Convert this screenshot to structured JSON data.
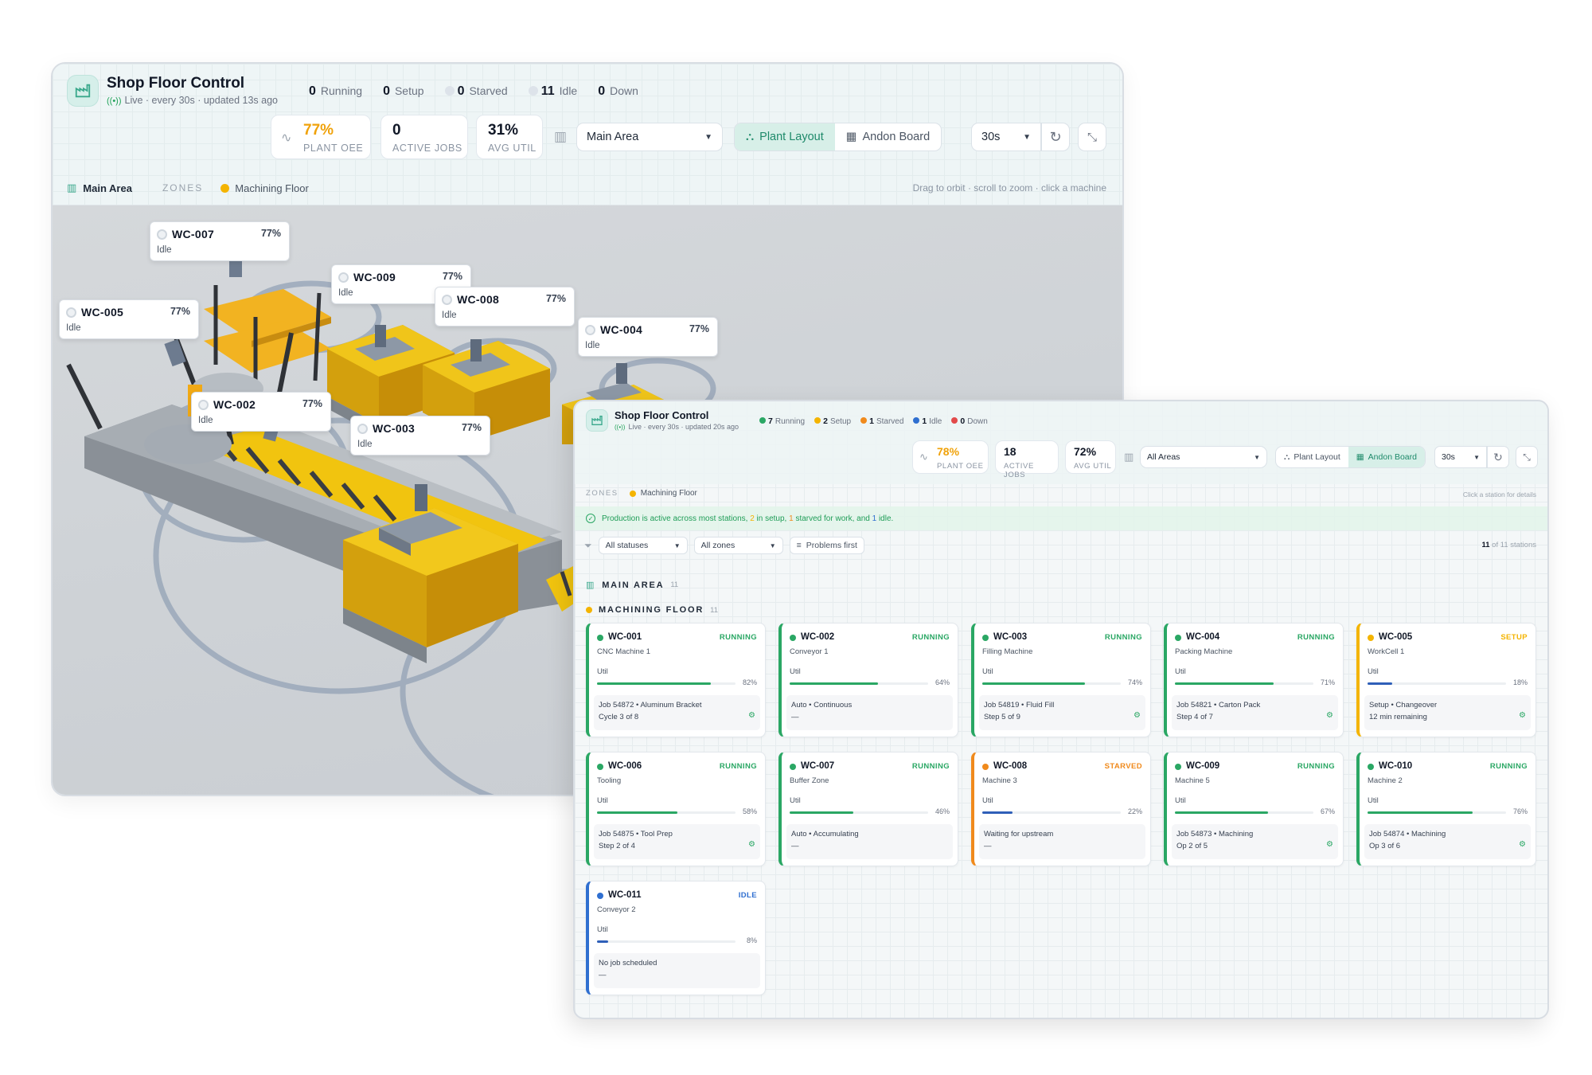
{
  "back": {
    "title": "Shop Floor Control",
    "subtitle": "Live · every 30s · updated 13s ago",
    "counts": [
      {
        "value": "0",
        "label": "Running"
      },
      {
        "value": "0",
        "label": "Setup"
      },
      {
        "value": "0",
        "label": "Starved"
      },
      {
        "value": "11",
        "label": "Idle"
      },
      {
        "value": "0",
        "label": "Down"
      }
    ],
    "kpis": {
      "oee": {
        "value": "77%",
        "label": "Plant OEE"
      },
      "jobs": {
        "value": "0",
        "label": "Active Jobs"
      },
      "util": {
        "value": "31%",
        "label": "Avg Util"
      }
    },
    "area_select": "Main Area",
    "view_plant": "Plant Layout",
    "view_andon": "Andon Board",
    "interval": "30s",
    "area_label": "Main Area",
    "zones_label": "ZONES",
    "zone_name": "Machining Floor",
    "hint": "Drag to orbit · scroll to zoom · click a machine",
    "machines": [
      {
        "id": "WC-007",
        "pct": "77%",
        "status": "Idle"
      },
      {
        "id": "WC-009",
        "pct": "77%",
        "status": "Idle"
      },
      {
        "id": "WC-005",
        "pct": "77%",
        "status": "Idle"
      },
      {
        "id": "WC-008",
        "pct": "77%",
        "status": "Idle"
      },
      {
        "id": "WC-004",
        "pct": "77%",
        "status": "Idle"
      },
      {
        "id": "WC-002",
        "pct": "77%",
        "status": "Idle"
      },
      {
        "id": "WC-003",
        "pct": "77%",
        "status": "Idle"
      }
    ]
  },
  "front": {
    "title": "Shop Floor Control",
    "subtitle": "Live · every 30s · updated 20s ago",
    "counts": [
      {
        "value": "7",
        "label": "Running",
        "color": "#2aa764"
      },
      {
        "value": "2",
        "label": "Setup",
        "color": "#f4b400"
      },
      {
        "value": "1",
        "label": "Starved",
        "color": "#f08a1c"
      },
      {
        "value": "1",
        "label": "Idle",
        "color": "#2f6fd0"
      },
      {
        "value": "0",
        "label": "Down",
        "color": "#e24a4a"
      }
    ],
    "kpis": {
      "oee": {
        "value": "78%",
        "label": "Plant OEE"
      },
      "jobs": {
        "value": "18",
        "label": "Active Jobs"
      },
      "util": {
        "value": "72%",
        "label": "Avg Util"
      }
    },
    "area_select": "All Areas",
    "view_plant": "Plant Layout",
    "view_andon": "Andon Board",
    "interval": "30s",
    "zones_label": "ZONES",
    "zone_name": "Machining Floor",
    "zone_hint": "Click a station for details",
    "banner": {
      "a": "Production is active across most stations, ",
      "n1": "2",
      "b": " in setup, ",
      "n2": "1",
      "c": " starved for work, and ",
      "n3": "1",
      "d": " idle."
    },
    "filters": {
      "status": "All statuses",
      "zones": "All zones",
      "problems": "Problems first"
    },
    "station_count": {
      "shown": "11",
      "rest": " of 11 stations"
    },
    "section_area": {
      "label": "MAIN AREA",
      "count": "11"
    },
    "section_zone": {
      "label": "MACHINING FLOOR",
      "count": "11"
    },
    "util_label": "Util",
    "stations": [
      {
        "id": "WC-001",
        "name": "CNC Machine 1",
        "status": "RUNNING",
        "util": 82,
        "util_text": "82%",
        "line1": "Job 54872 • Aluminum Bracket",
        "line2": "Cycle 3 of 8",
        "kind": "running"
      },
      {
        "id": "WC-002",
        "name": "Conveyor 1",
        "status": "RUNNING",
        "util": 64,
        "util_text": "64%",
        "line1": "Auto • Continuous",
        "line2": "—",
        "kind": "running"
      },
      {
        "id": "WC-003",
        "name": "Filling Machine",
        "status": "RUNNING",
        "util": 74,
        "util_text": "74%",
        "line1": "Job 54819 • Fluid Fill",
        "line2": "Step 5 of 9",
        "kind": "running"
      },
      {
        "id": "WC-004",
        "name": "Packing Machine",
        "status": "RUNNING",
        "util": 71,
        "util_text": "71%",
        "line1": "Job 54821 • Carton Pack",
        "line2": "Step 4 of 7",
        "kind": "running"
      },
      {
        "id": "WC-005",
        "name": "WorkCell 1",
        "status": "SETUP",
        "util": 18,
        "util_text": "18%",
        "line1": "Setup • Changeover",
        "line2": "12 min remaining",
        "kind": "setup"
      },
      {
        "id": "WC-006",
        "name": "Tooling",
        "status": "RUNNING",
        "util": 58,
        "util_text": "58%",
        "line1": "Job 54875 • Tool Prep",
        "line2": "Step 2 of 4",
        "kind": "running"
      },
      {
        "id": "WC-007",
        "name": "Buffer Zone",
        "status": "RUNNING",
        "util": 46,
        "util_text": "46%",
        "line1": "Auto • Accumulating",
        "line2": "—",
        "kind": "running"
      },
      {
        "id": "WC-008",
        "name": "Machine 3",
        "status": "STARVED",
        "util": 22,
        "util_text": "22%",
        "line1": "Waiting for upstream",
        "line2": "—",
        "kind": "starved"
      },
      {
        "id": "WC-009",
        "name": "Machine 5",
        "status": "RUNNING",
        "util": 67,
        "util_text": "67%",
        "line1": "Job 54873 • Machining",
        "line2": "Op 2 of 5",
        "kind": "running"
      },
      {
        "id": "WC-010",
        "name": "Machine 2",
        "status": "RUNNING",
        "util": 76,
        "util_text": "76%",
        "line1": "Job 54874 • Machining",
        "line2": "Op 3 of 6",
        "kind": "running"
      },
      {
        "id": "WC-011",
        "name": "Conveyor 2",
        "status": "IDLE",
        "util": 8,
        "util_text": "8%",
        "line1": "No job scheduled",
        "line2": "—",
        "kind": "idle"
      }
    ]
  },
  "colors": {
    "running": "#2aa764",
    "setup": "#f4b400",
    "starved": "#f08a1c",
    "idle": "#2f6fd0",
    "down": "#e24a4a",
    "oee": "#f0a20a",
    "accent": "#1e8a6a"
  }
}
